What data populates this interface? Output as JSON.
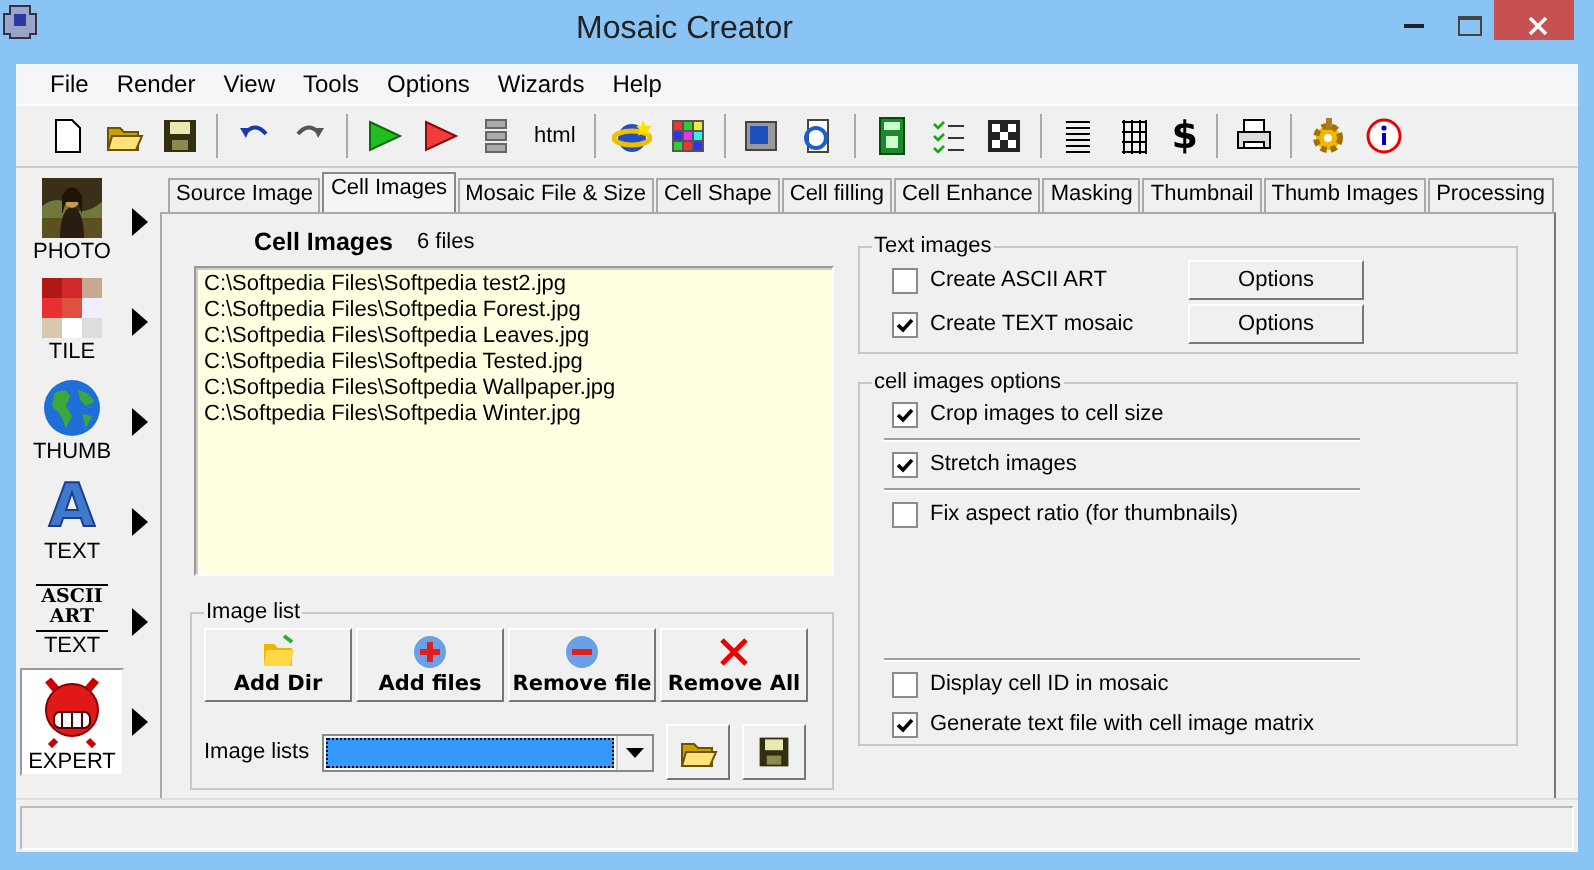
{
  "window": {
    "title": "Mosaic Creator"
  },
  "menu": [
    "File",
    "Render",
    "View",
    "Tools",
    "Options",
    "Wizards",
    "Help"
  ],
  "toolbar": [
    {
      "kind": "new"
    },
    {
      "kind": "open"
    },
    {
      "kind": "save"
    },
    {
      "kind": "separator"
    },
    {
      "kind": "undo"
    },
    {
      "kind": "redo"
    },
    {
      "kind": "separator"
    },
    {
      "kind": "play_green"
    },
    {
      "kind": "play_red"
    },
    {
      "kind": "bars"
    },
    {
      "kind": "text",
      "text": "html"
    },
    {
      "kind": "separator"
    },
    {
      "kind": "globe"
    },
    {
      "kind": "color_grid"
    },
    {
      "kind": "separator"
    },
    {
      "kind": "monitor"
    },
    {
      "kind": "web_page"
    },
    {
      "kind": "separator"
    },
    {
      "kind": "calculator"
    },
    {
      "kind": "checklist"
    },
    {
      "kind": "checker"
    },
    {
      "kind": "separator"
    },
    {
      "kind": "lines"
    },
    {
      "kind": "grid"
    },
    {
      "kind": "text",
      "text": "$"
    },
    {
      "kind": "separator"
    },
    {
      "kind": "printer"
    },
    {
      "kind": "separator"
    },
    {
      "kind": "gear"
    },
    {
      "kind": "info"
    }
  ],
  "sidebar": [
    {
      "label": "PHOTO",
      "selected": false
    },
    {
      "kind": "tile",
      "label": "TILE",
      "selected": false
    },
    {
      "kind": "globe",
      "label": "THUMB",
      "selected": false
    },
    {
      "kind": "letter",
      "icon_text": "A",
      "label": "TEXT",
      "selected": false
    },
    {
      "kind": "ascii",
      "icon_text": "ASCII ART",
      "label": "TEXT",
      "selected": false
    },
    {
      "kind": "expert",
      "label": "EXPERT",
      "selected": true
    }
  ],
  "tabs": [
    {
      "label": "Source Image",
      "selected": false
    },
    {
      "label": "Cell Images",
      "selected": true
    },
    {
      "label": "Mosaic File & Size",
      "selected": false
    },
    {
      "label": "Cell Shape",
      "selected": false
    },
    {
      "label": "Cell filling",
      "selected": false
    },
    {
      "label": "Cell Enhance",
      "selected": false
    },
    {
      "label": "Masking",
      "selected": false
    },
    {
      "label": "Thumbnail",
      "selected": false
    },
    {
      "label": "Thumb Images",
      "selected": false
    },
    {
      "label": "Processing",
      "selected": false
    }
  ],
  "cell_images": {
    "heading": "Cell Images",
    "count": "6 files",
    "files": [
      "C:\\Softpedia Files\\Softpedia test2.jpg",
      "C:\\Softpedia Files\\Softpedia Forest.jpg",
      "C:\\Softpedia Files\\Softpedia Leaves.jpg",
      "C:\\Softpedia Files\\Softpedia Tested.jpg",
      "C:\\Softpedia Files\\Softpedia Wallpaper.jpg",
      "C:\\Softpedia Files\\Softpedia Winter.jpg"
    ],
    "image_list": {
      "title": "Image list",
      "buttons": [
        {
          "kind": "add_dir",
          "label": "Add Dir"
        },
        {
          "kind": "add",
          "label": "Add files"
        },
        {
          "kind": "remove",
          "label": "Remove file"
        },
        {
          "kind": "remove_all",
          "label": "Remove All"
        }
      ],
      "lists_label": "Image lists"
    }
  },
  "text_images": {
    "title": "Text images",
    "options": [
      {
        "label": "Create ASCII ART",
        "checked": false,
        "button": "Options"
      },
      {
        "label": "Create TEXT mosaic",
        "checked": true,
        "button": "Options"
      }
    ]
  },
  "cell_options": {
    "title": "cell images options",
    "options": [
      {
        "label": "Crop images to cell size",
        "checked": true
      },
      {
        "label": "Stretch images",
        "checked": true
      },
      {
        "label": "Fix aspect ratio (for thumbnails)",
        "checked": false
      }
    ],
    "footer_options": [
      {
        "label": "Display cell ID in mosaic",
        "checked": false
      },
      {
        "label": "Generate text file with cell image matrix",
        "checked": true
      }
    ]
  }
}
